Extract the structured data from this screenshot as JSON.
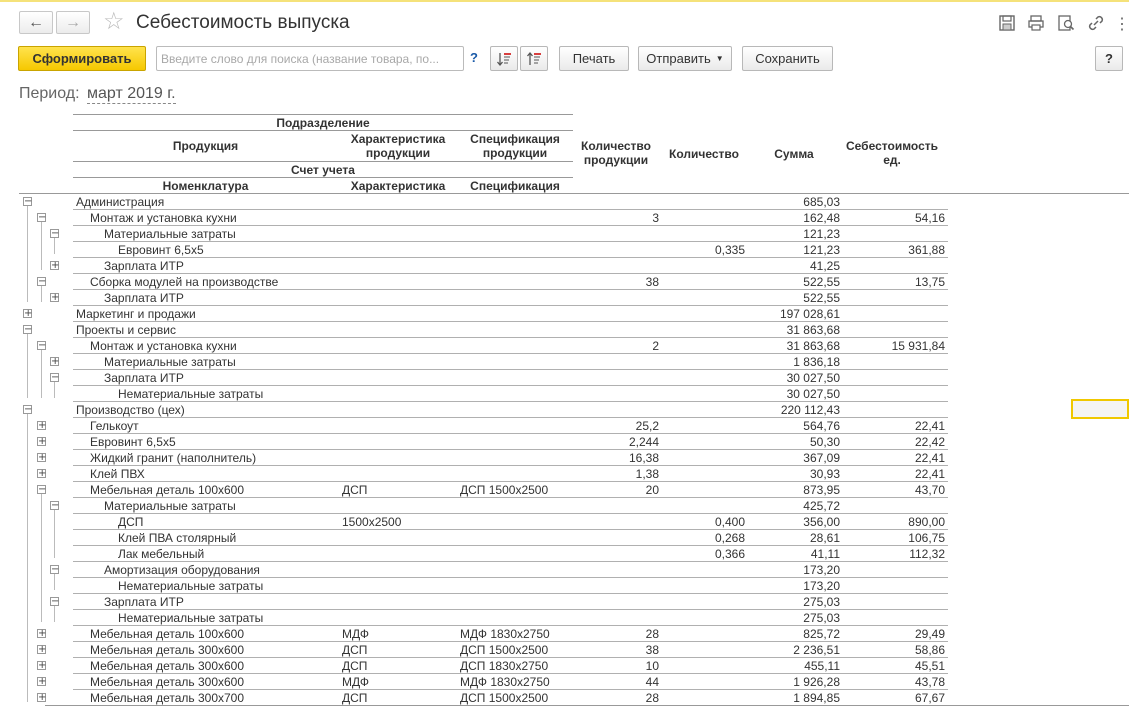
{
  "window": {
    "title": "Себестоимость выпуска"
  },
  "toolbar": {
    "generate_label": "Сформировать",
    "search_placeholder": "Введите слово для поиска (название товара, по...",
    "help_label": "?",
    "print_label": "Печать",
    "send_label": "Отправить",
    "save_label": "Сохранить",
    "help_button_label": "?"
  },
  "period": {
    "label": "Период:",
    "value": "март 2019 г."
  },
  "columns": {
    "division": "Подразделение",
    "product": "Продукция",
    "product_char": "Характеристика продукции",
    "product_spec": "Спецификация продукции",
    "account": "Счет учета",
    "nomenclature": "Номенклатура",
    "characteristic": "Характеристика",
    "specification": "Спецификация",
    "product_qty": "Количество продукции",
    "qty": "Количество",
    "sum": "Сумма",
    "unit_cost": "Себестоимость ед."
  },
  "rows": [
    {
      "level": 0,
      "toggle": "minus",
      "name": "Администрация",
      "char": "",
      "spec": "",
      "pqty": "",
      "qty": "",
      "sum": "685,03",
      "unit": ""
    },
    {
      "level": 1,
      "toggle": "minus",
      "name": "Монтаж и установка кухни",
      "char": "",
      "spec": "",
      "pqty": "3",
      "qty": "",
      "sum": "162,48",
      "unit": "54,16"
    },
    {
      "level": 2,
      "toggle": "minus",
      "name": "Материальные затраты",
      "char": "",
      "spec": "",
      "pqty": "",
      "qty": "",
      "sum": "121,23",
      "unit": ""
    },
    {
      "level": 3,
      "toggle": "",
      "name": "Евровинт 6,5х5",
      "char": "",
      "spec": "",
      "pqty": "",
      "qty": "0,335",
      "sum": "121,23",
      "unit": "361,88"
    },
    {
      "level": 2,
      "toggle": "plus",
      "name": "Зарплата ИТР",
      "char": "",
      "spec": "",
      "pqty": "",
      "qty": "",
      "sum": "41,25",
      "unit": ""
    },
    {
      "level": 1,
      "toggle": "minus",
      "name": "Сборка модулей на производстве",
      "char": "",
      "spec": "",
      "pqty": "38",
      "qty": "",
      "sum": "522,55",
      "unit": "13,75"
    },
    {
      "level": 2,
      "toggle": "plus",
      "name": "Зарплата ИТР",
      "char": "",
      "spec": "",
      "pqty": "",
      "qty": "",
      "sum": "522,55",
      "unit": ""
    },
    {
      "level": 0,
      "toggle": "plus",
      "name": "Маркетинг и продажи",
      "char": "",
      "spec": "",
      "pqty": "",
      "qty": "",
      "sum": "197 028,61",
      "unit": ""
    },
    {
      "level": 0,
      "toggle": "minus",
      "name": "Проекты и сервис",
      "char": "",
      "spec": "",
      "pqty": "",
      "qty": "",
      "sum": "31 863,68",
      "unit": ""
    },
    {
      "level": 1,
      "toggle": "minus",
      "name": "Монтаж и установка кухни",
      "char": "",
      "spec": "",
      "pqty": "2",
      "qty": "",
      "sum": "31 863,68",
      "unit": "15 931,84"
    },
    {
      "level": 2,
      "toggle": "plus",
      "name": "Материальные затраты",
      "char": "",
      "spec": "",
      "pqty": "",
      "qty": "",
      "sum": "1 836,18",
      "unit": ""
    },
    {
      "level": 2,
      "toggle": "minus",
      "name": "Зарплата ИТР",
      "char": "",
      "spec": "",
      "pqty": "",
      "qty": "",
      "sum": "30 027,50",
      "unit": ""
    },
    {
      "level": 3,
      "toggle": "",
      "name": "Нематериальные затраты",
      "char": "",
      "spec": "",
      "pqty": "",
      "qty": "",
      "sum": "30 027,50",
      "unit": ""
    },
    {
      "level": 0,
      "toggle": "minus",
      "name": "Производство (цех)",
      "char": "",
      "spec": "",
      "pqty": "",
      "qty": "",
      "sum": "220 112,43",
      "unit": ""
    },
    {
      "level": 1,
      "toggle": "plus",
      "name": "Гелькоут",
      "char": "",
      "spec": "",
      "pqty": "25,2",
      "qty": "",
      "sum": "564,76",
      "unit": "22,41"
    },
    {
      "level": 1,
      "toggle": "plus",
      "name": "Евровинт 6,5х5",
      "char": "",
      "spec": "",
      "pqty": "2,244",
      "qty": "",
      "sum": "50,30",
      "unit": "22,42"
    },
    {
      "level": 1,
      "toggle": "plus",
      "name": "Жидкий гранит (наполнитель)",
      "char": "",
      "spec": "",
      "pqty": "16,38",
      "qty": "",
      "sum": "367,09",
      "unit": "22,41"
    },
    {
      "level": 1,
      "toggle": "plus",
      "name": "Клей ПВХ",
      "char": "",
      "spec": "",
      "pqty": "1,38",
      "qty": "",
      "sum": "30,93",
      "unit": "22,41"
    },
    {
      "level": 1,
      "toggle": "minus",
      "name": "Мебельная деталь 100х600",
      "char": "ДСП",
      "spec": "ДСП 1500х2500",
      "pqty": "20",
      "qty": "",
      "sum": "873,95",
      "unit": "43,70"
    },
    {
      "level": 2,
      "toggle": "minus",
      "name": "Материальные затраты",
      "char": "",
      "spec": "",
      "pqty": "",
      "qty": "",
      "sum": "425,72",
      "unit": ""
    },
    {
      "level": 3,
      "toggle": "",
      "name": "ДСП",
      "char": "1500х2500",
      "spec": "",
      "pqty": "",
      "qty": "0,400",
      "sum": "356,00",
      "unit": "890,00"
    },
    {
      "level": 3,
      "toggle": "",
      "name": "Клей ПВА столярный",
      "char": "",
      "spec": "",
      "pqty": "",
      "qty": "0,268",
      "sum": "28,61",
      "unit": "106,75"
    },
    {
      "level": 3,
      "toggle": "",
      "name": "Лак мебельный",
      "char": "",
      "spec": "",
      "pqty": "",
      "qty": "0,366",
      "sum": "41,11",
      "unit": "112,32"
    },
    {
      "level": 2,
      "toggle": "minus",
      "name": "Амортизация оборудования",
      "char": "",
      "spec": "",
      "pqty": "",
      "qty": "",
      "sum": "173,20",
      "unit": ""
    },
    {
      "level": 3,
      "toggle": "",
      "name": "Нематериальные затраты",
      "char": "",
      "spec": "",
      "pqty": "",
      "qty": "",
      "sum": "173,20",
      "unit": ""
    },
    {
      "level": 2,
      "toggle": "minus",
      "name": "Зарплата ИТР",
      "char": "",
      "spec": "",
      "pqty": "",
      "qty": "",
      "sum": "275,03",
      "unit": ""
    },
    {
      "level": 3,
      "toggle": "",
      "name": "Нематериальные затраты",
      "char": "",
      "spec": "",
      "pqty": "",
      "qty": "",
      "sum": "275,03",
      "unit": ""
    },
    {
      "level": 1,
      "toggle": "plus",
      "name": "Мебельная деталь 100х600",
      "char": "МДФ",
      "spec": "МДФ 1830х2750",
      "pqty": "28",
      "qty": "",
      "sum": "825,72",
      "unit": "29,49"
    },
    {
      "level": 1,
      "toggle": "plus",
      "name": "Мебельная деталь 300х600",
      "char": "ДСП",
      "spec": "ДСП 1500х2500",
      "pqty": "38",
      "qty": "",
      "sum": "2 236,51",
      "unit": "58,86"
    },
    {
      "level": 1,
      "toggle": "plus",
      "name": "Мебельная деталь 300х600",
      "char": "ДСП",
      "spec": "ДСП 1830х2750",
      "pqty": "10",
      "qty": "",
      "sum": "455,11",
      "unit": "45,51"
    },
    {
      "level": 1,
      "toggle": "plus",
      "name": "Мебельная деталь 300х600",
      "char": "МДФ",
      "spec": "МДФ 1830х2750",
      "pqty": "44",
      "qty": "",
      "sum": "1 926,28",
      "unit": "43,78"
    },
    {
      "level": 1,
      "toggle": "plus",
      "name": "Мебельная деталь 300х700",
      "char": "ДСП",
      "spec": "ДСП 1500х2500",
      "pqty": "28",
      "qty": "",
      "sum": "1 894,85",
      "unit": "67,67"
    }
  ]
}
